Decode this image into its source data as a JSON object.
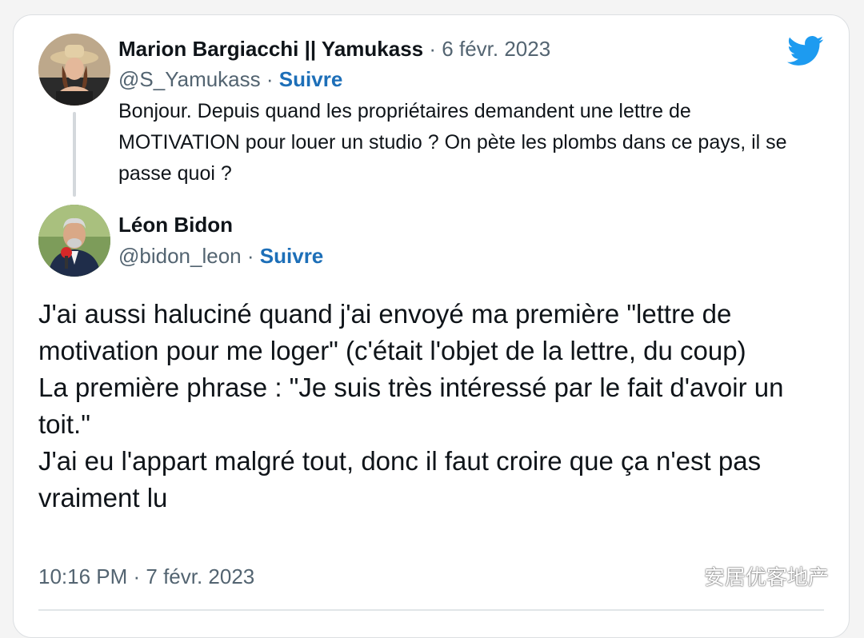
{
  "parent_tweet": {
    "display_name": "Marion Bargiacchi || Yamukass",
    "date": "6 févr. 2023",
    "handle": "@S_Yamukass",
    "follow_label": "Suivre",
    "text": "Bonjour. Depuis quand les propriétaires demandent une lettre de MOTIVATION pour louer un studio ? On pète les plombs dans ce pays, il se passe quoi ?"
  },
  "main_tweet": {
    "display_name": "Léon Bidon",
    "handle": "@bidon_leon",
    "follow_label": "Suivre",
    "paragraphs": [
      "J'ai aussi haluciné quand j'ai envoyé ma première \"lettre de motivation pour me loger\" (c'était l'objet de la lettre, du coup)",
      "La première phrase : \"Je suis très intéressé par le fait d'avoir un toit.\"",
      "J'ai eu l'appart malgré tout, donc il faut croire que ça n'est pas vraiment lu"
    ],
    "timestamp": "10:16 PM · 7 févr. 2023"
  },
  "separator": "·",
  "watermark": {
    "text": "安居优客地产",
    "icon": "wechat-icon"
  },
  "icons": {
    "brand": "twitter-bird-icon"
  },
  "colors": {
    "twitter_blue": "#1d9bf0",
    "follow_blue": "#1d6fb8",
    "secondary_text": "#536471"
  }
}
